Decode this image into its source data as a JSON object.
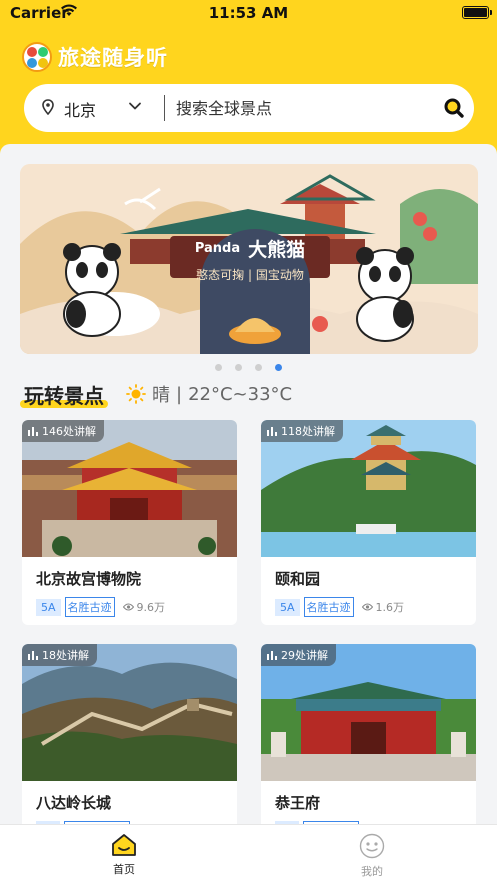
{
  "status_bar": {
    "carrier": "Carrier",
    "time": "11:53 AM"
  },
  "app": {
    "title": "旅途随身听"
  },
  "search": {
    "city": "北京",
    "placeholder": "搜索全球景点"
  },
  "banner": {
    "brand": "Panda",
    "title": "大熊猫",
    "subtitle": "憨态可掬 | 国宝动物",
    "dot_count": 4,
    "active_dot": 4
  },
  "section": {
    "title": "玩转景点",
    "weather": {
      "condition": "晴",
      "separator": "|",
      "temperature": "22°C~33°C"
    }
  },
  "spots": [
    {
      "name": "北京故宫博物院",
      "badge": "146处讲解",
      "level": "5A",
      "category": "名胜古迹",
      "views": "9.6万"
    },
    {
      "name": "颐和园",
      "badge": "118处讲解",
      "level": "5A",
      "category": "名胜古迹",
      "views": "1.6万"
    },
    {
      "name": "八达岭长城",
      "badge": "18处讲解",
      "level": "",
      "category": "",
      "views": ""
    },
    {
      "name": "恭王府",
      "badge": "29处讲解",
      "level": "",
      "category": "",
      "views": ""
    }
  ],
  "tabbar": {
    "home": "首页",
    "mine": "我的"
  },
  "colors": {
    "brand_yellow": "#FFD51E",
    "accent_blue": "#3B86EA"
  }
}
